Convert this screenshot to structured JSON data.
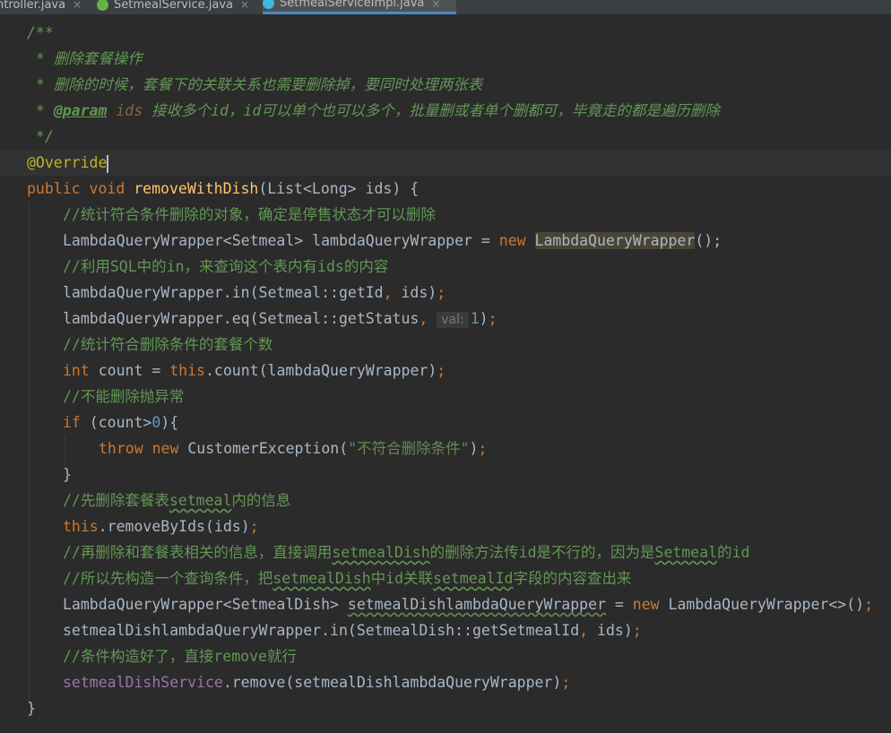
{
  "tabs": [
    {
      "label": "ntroller.java",
      "close": "×"
    },
    {
      "label": "SetmealService.java",
      "close": "×"
    },
    {
      "label": "SetmealServiceImpl.java",
      "close": "×",
      "active": true
    }
  ],
  "code": {
    "l1": "/**",
    "l2": " * 删除套餐操作",
    "l3": " * 删除的时候，套餐下的关联关系也需要删除掉，要同时处理两张表",
    "l4_prefix": " * ",
    "l4_tag": "@param",
    "l4_name": "ids",
    "l4_text": " 接收多个id，id可以单个也可以多个，批量删或者单个删都可，毕竟走的都是遍历删除",
    "l5": " */",
    "l6": "@Override",
    "l7_kw1": "public",
    "l7_kw2": "void",
    "l7_fn": "removeWithDish",
    "l7_rest": "(List<Long> ids) {",
    "l8": "//统计符合条件删除的对象，确定是停售状态才可以删除",
    "l9_a": "LambdaQueryWrapper<Setmeal> lambdaQueryWrapper = ",
    "l9_kw": "new",
    "l9_ctor": "LambdaQueryWrapper",
    "l9_b": "();",
    "l10": "//利用SQL中的in，来查询这个表内有ids的内容",
    "l11_a": "lambdaQueryWrapper.in(Setmeal::getId",
    "l11_comma": ",",
    "l11_b": " ids)",
    "l11_semi": ";",
    "l12_a": "lambdaQueryWrapper.eq(Setmeal::getStatus",
    "l12_comma": ",",
    "l12_hint": "val:",
    "l12_num": "1",
    "l12_b": ")",
    "l12_semi": ";",
    "l13": "//统计符合删除条件的套餐个数",
    "l14_kw": "int",
    "l14_a": " count = ",
    "l14_this": "this",
    "l14_b": ".count(lambdaQueryWrapper)",
    "l14_semi": ";",
    "l15": "//不能删除抛异常",
    "l16_kw": "if",
    "l16_a": " (count>",
    "l16_num": "0",
    "l16_b": "){",
    "l17_kw1": "throw",
    "l17_kw2": "new",
    "l17_a": " CustomerException(",
    "l17_str": "\"不符合删除条件\"",
    "l17_b": ")",
    "l17_semi": ";",
    "l18": "}",
    "l19_a": "//先删除套餐表",
    "l19_link": "setmeal",
    "l19_b": "内的信息",
    "l20_this": "this",
    "l20_a": ".removeByIds(ids)",
    "l20_semi": ";",
    "l21_a": "//再删除和套餐表相关的信息，直接调用",
    "l21_link1": "setmealDish",
    "l21_b": "的删除方法传id是不行的，因为是",
    "l21_link2": "Setmeal",
    "l21_c": "的id",
    "l22_a": "//所以先构造一个查询条件，把",
    "l22_link1": "setmealDish",
    "l22_b": "中id关联",
    "l22_link2": "setmealId",
    "l22_c": "字段的内容查出来",
    "l23_a": "LambdaQueryWrapper<SetmealDish> ",
    "l23_var": "setmealDishlambdaQueryWrapper",
    "l23_b": " = ",
    "l23_kw": "new",
    "l23_c": " LambdaQueryWrapper<>()",
    "l23_semi": ";",
    "l24_a": "setmealDishlambdaQueryWrapper.in(SetmealDish::getSetmealId",
    "l24_comma": ",",
    "l24_b": " ids)",
    "l24_semi": ";",
    "l25": "//条件构造好了，直接remove就行",
    "l26_field": "setmealDishService",
    "l26_a": ".remove(setmealDishlambdaQueryWrapper)",
    "l26_semi": ";",
    "l27": "}"
  },
  "colors": {
    "background": "#2b2b2b",
    "keyword": "#cc7832",
    "comment": "#629755",
    "function": "#ffc66d",
    "string": "#6a8759",
    "number": "#6897bb",
    "annotation": "#bbb529",
    "field": "#9876aa"
  }
}
